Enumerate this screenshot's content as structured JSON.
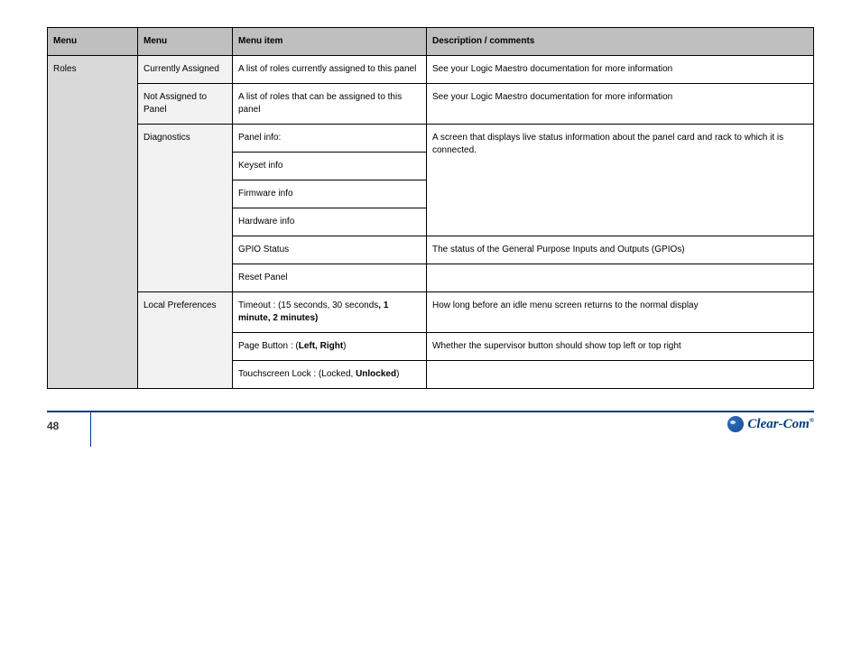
{
  "headers": {
    "c1": "Menu",
    "c2": "Menu",
    "c3": "Menu item",
    "c4": "Description / comments"
  },
  "footer": {
    "page": "48",
    "brand": "Clear-Com"
  },
  "rows": [
    {
      "menu": "Roles",
      "menu_span": 11,
      "sub": "Currently Assigned",
      "sub_span": 1,
      "item": "A list of roles currently assigned to this panel",
      "desc": "See your Logic Maestro documentation for more information"
    },
    {
      "sub": "Not Assigned to Panel",
      "sub_span": 1,
      "item": "A list of roles that can be assigned to this panel",
      "desc": "See your Logic Maestro documentation for more information"
    },
    {
      "sub": "Diagnostics",
      "sub_span": 6,
      "item": "Panel info:",
      "desc_span": 4,
      "desc": "A screen that displays live status information about the panel card and rack to which it is connected."
    },
    {
      "item": "Keyset info"
    },
    {
      "item": "Firmware info"
    },
    {
      "item": "Hardware info"
    },
    {
      "item": "GPIO Status",
      "desc": "The status of the General Purpose Inputs and Outputs (GPIOs)"
    },
    {
      "item": "Reset Panel",
      "desc": ""
    },
    {
      "sub": "Local Preferences",
      "sub_span": 3,
      "item": "Timeout : (15 seconds, 30 seconds",
      "bold_suffix": ", 1 minute, 2 minutes)",
      "desc": "How long before an idle menu screen returns to the normal display"
    },
    {
      "item": "Page Button : (",
      "bold_suffix": "Left, Right",
      "suffix2": ")",
      "desc": "Whether the supervisor button should show top left or top right"
    },
    {
      "item": "Touchscreen Lock : (Locked, ",
      "bold_suffix": "Unlocked",
      "suffix2": ")",
      "desc": ""
    }
  ]
}
